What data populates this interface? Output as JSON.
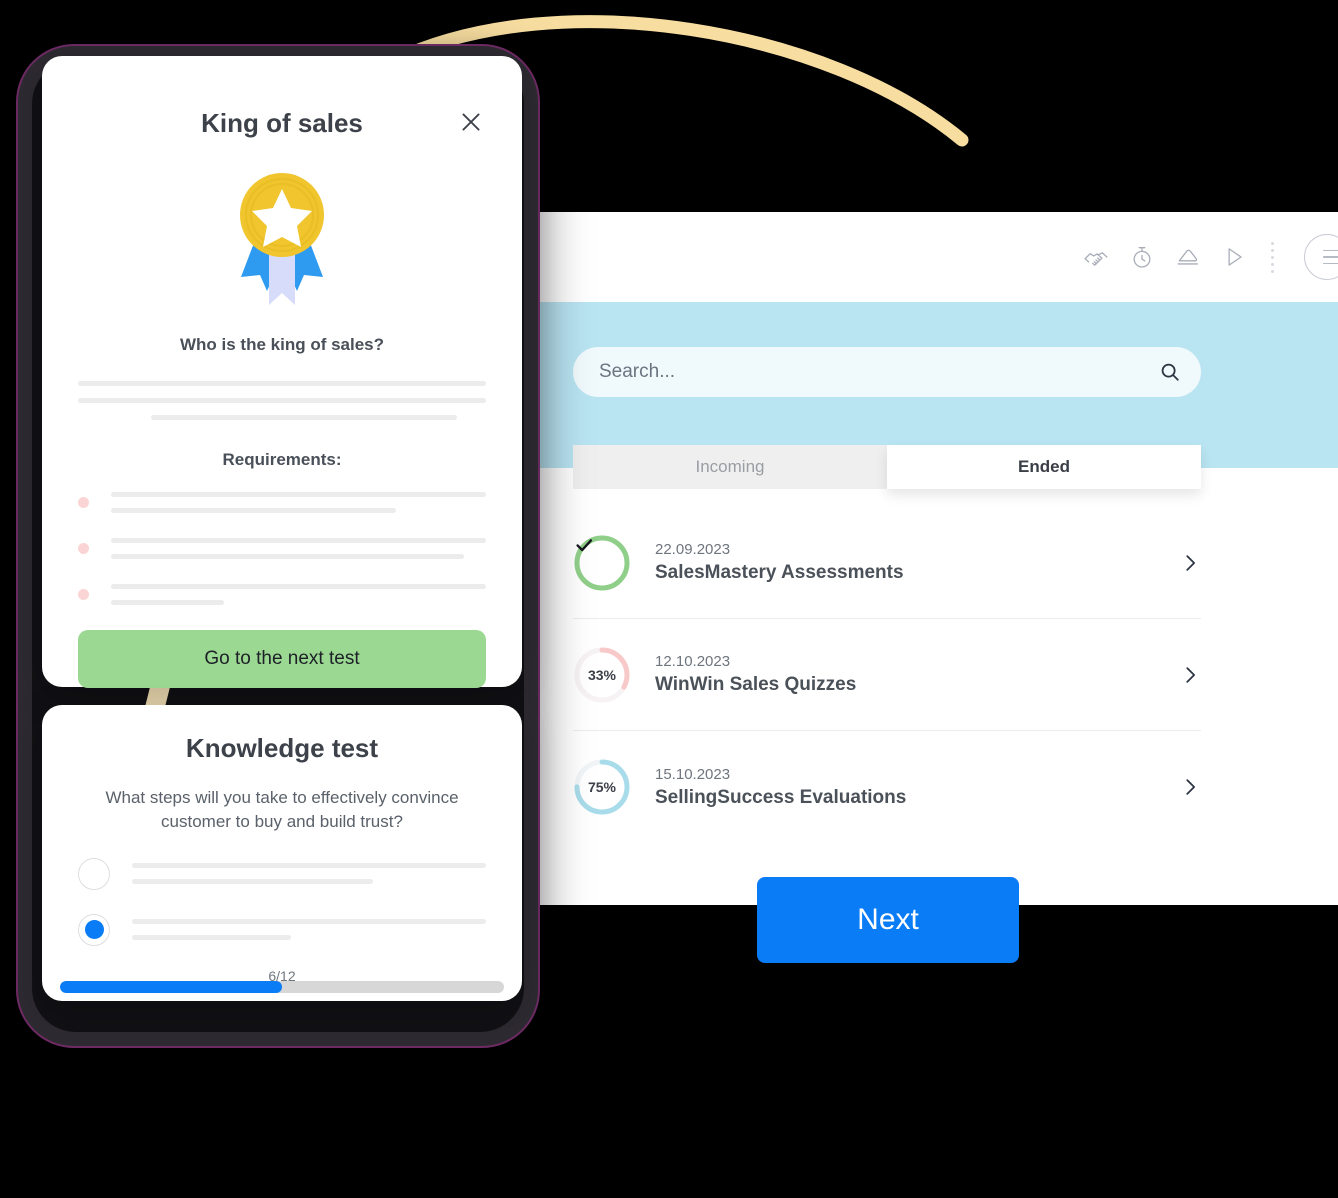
{
  "colors": {
    "accent_blue": "#0a7cf5",
    "band_blue": "#b9e4f2",
    "green_button": "#9bd892",
    "ring_green": "#90cf8a",
    "ring_pink": "#f8c9c9",
    "ring_blue": "#a9dcea",
    "arc_yellow": "#f7dda0",
    "phone_outline": "#6d2a63"
  },
  "decor": {
    "arc_name": "yellow-arc",
    "stripe_name": "yellow-stripe"
  },
  "panel": {
    "topbar": {
      "icons": [
        {
          "name": "handshake-icon"
        },
        {
          "name": "stopwatch-icon"
        },
        {
          "name": "eraser-icon"
        },
        {
          "name": "play-icon"
        }
      ],
      "divider_name": "vertical-dots-divider",
      "menu_name": "circle-menu-icon"
    },
    "search": {
      "placeholder": "Search...",
      "value": "",
      "icon": "search-icon"
    },
    "tabs": [
      {
        "label": "Incoming",
        "active": false
      },
      {
        "label": "Ended",
        "active": true
      }
    ],
    "list": [
      {
        "date": "22.09.2023",
        "title": "SalesMastery Assessments",
        "status": "complete",
        "percent": 100,
        "percent_label": "",
        "ring_color": "#90cf8a",
        "icon": "check-icon"
      },
      {
        "date": "12.10.2023",
        "title": "WinWin Sales Quizzes",
        "status": "partial",
        "percent": 33,
        "percent_label": "33%",
        "ring_color": "#f8c9c9",
        "icon": ""
      },
      {
        "date": "15.10.2023",
        "title": "SellingSuccess Evaluations",
        "status": "partial",
        "percent": 75,
        "percent_label": "75%",
        "ring_color": "#a9dcea",
        "icon": ""
      }
    ],
    "chevron_icon": "chevron-right-icon"
  },
  "next_button": {
    "label": "Next"
  },
  "king_card": {
    "title": "King of sales",
    "close_icon": "close-icon",
    "badge_icon": "award-medal-icon",
    "question": "Who is the king of sales?",
    "requirements_label": "Requirements:",
    "cta_label": "Go to the next test"
  },
  "knowledge_card": {
    "title": "Knowledge test",
    "question": "What steps will you take to effectively convince customer to buy and build trust?",
    "options": [
      {
        "selected": false
      },
      {
        "selected": true
      }
    ],
    "counter": "6/12",
    "progress_percent": 50
  }
}
